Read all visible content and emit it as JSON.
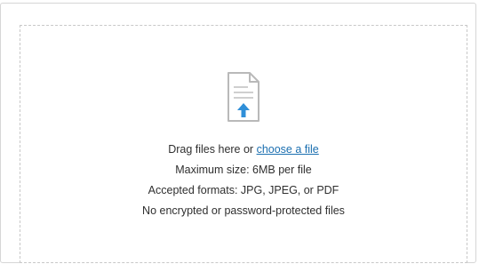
{
  "upload": {
    "icon": "document-upload-icon",
    "drag_text": "Drag files here or ",
    "choose_link": "choose a file",
    "max_size": "Maximum size: 6MB per file",
    "formats": "Accepted formats: JPG, JPEG, or PDF",
    "restriction": "No encrypted or password-protected files",
    "colors": {
      "link": "#1b6fb0",
      "arrow": "#2f8fd8",
      "icon_stroke": "#b9b9b9",
      "dashed_border": "#c8c8c8"
    }
  }
}
